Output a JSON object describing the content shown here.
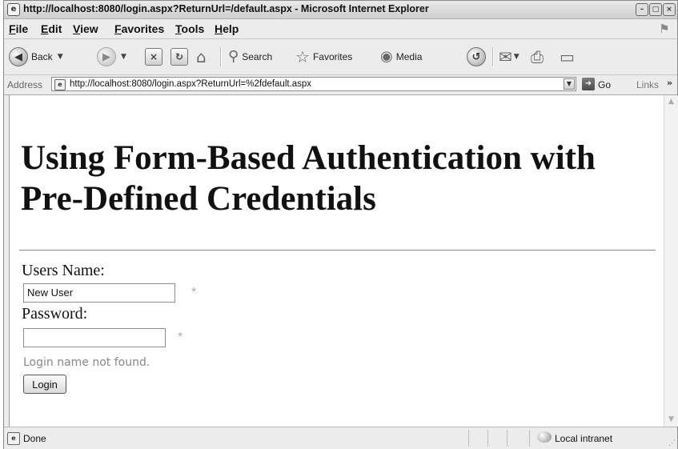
{
  "window": {
    "title": "http://localhost:8080/login.aspx?ReturnUrl=/default.aspx - Microsoft Internet Explorer"
  },
  "menu": {
    "items": [
      "File",
      "Edit",
      "View",
      "Favorites",
      "Tools",
      "Help"
    ]
  },
  "toolbar": {
    "back_label": "Back",
    "search_label": "Search",
    "favorites_label": "Favorites",
    "media_label": "Media"
  },
  "address": {
    "label": "Address",
    "url": "http://localhost:8080/login.aspx?ReturnUrl=%2fdefault.aspx",
    "go_label": "Go",
    "links_label": "Links",
    "links_chevron": "»"
  },
  "page": {
    "heading": "Using Form-Based Authentication with Pre-Defined Credentials",
    "username_label": "Users Name:",
    "username_value": "New User",
    "password_label": "Password:",
    "password_value": "",
    "required_marker": "*",
    "error_message": "Login name not found.",
    "login_button": "Login"
  },
  "status": {
    "text": "Done",
    "zone": "Local intranet"
  }
}
